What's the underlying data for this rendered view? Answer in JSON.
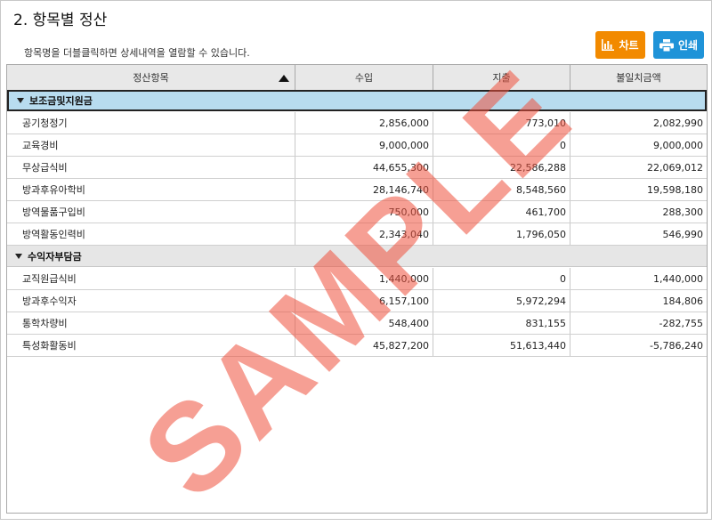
{
  "title": "2. 항목별 정산",
  "hint": "항목명을 더블클릭하면 상세내역을 열람할 수 있습니다.",
  "buttons": {
    "chart": "차트",
    "print": "인쇄"
  },
  "colors": {
    "chart_button": "#f28a00",
    "print_button": "#1f93d8",
    "negative": "#e8272d",
    "group_selected": "#b8dcef"
  },
  "columns": [
    "정산항목",
    "수입",
    "지출",
    "불일치금액"
  ],
  "sort": {
    "column": "정산항목",
    "direction": "ascending"
  },
  "groups": [
    {
      "label": "보조금및지원금",
      "rows": [
        {
          "name": "공기청정기",
          "income": "2,856,000",
          "expense": "773,010",
          "diff": "2,082,990"
        },
        {
          "name": "교육경비",
          "income": "9,000,000",
          "expense": "0",
          "diff": "9,000,000"
        },
        {
          "name": "무상급식비",
          "income": "44,655,300",
          "expense": "22,586,288",
          "diff": "22,069,012"
        },
        {
          "name": "방과후유아학비",
          "income": "28,146,740",
          "expense": "8,548,560",
          "diff": "19,598,180"
        },
        {
          "name": "방역물품구입비",
          "income": "750,000",
          "expense": "461,700",
          "diff": "288,300"
        },
        {
          "name": "방역활동인력비",
          "income": "2,343,040",
          "expense": "1,796,050",
          "diff": "546,990"
        }
      ]
    },
    {
      "label": "수익자부담금",
      "rows": [
        {
          "name": "교직원급식비",
          "income": "1,440,000",
          "expense": "0",
          "diff": "1,440,000"
        },
        {
          "name": "방과후수익자",
          "income": "6,157,100",
          "expense": "5,972,294",
          "diff": "184,806"
        },
        {
          "name": "통학차량비",
          "income": "548,400",
          "expense": "831,155",
          "diff": "-282,755"
        },
        {
          "name": "특성화활동비",
          "income": "45,827,200",
          "expense": "51,613,440",
          "diff": "-5,786,240"
        }
      ]
    }
  ],
  "watermark": "SAMPLE"
}
